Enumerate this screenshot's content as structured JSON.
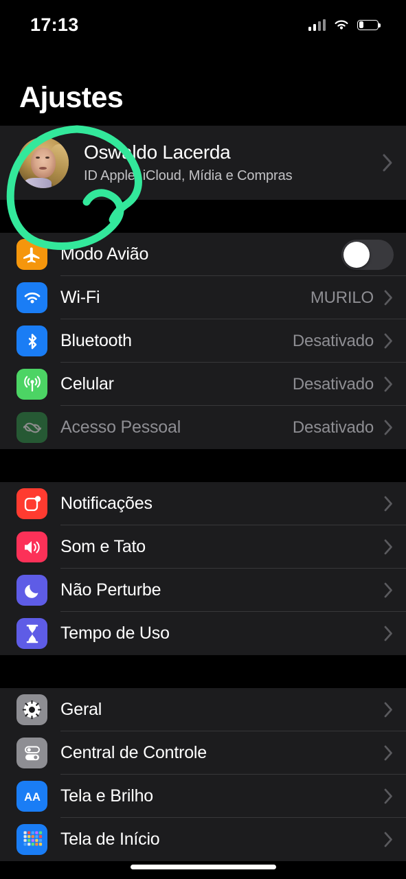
{
  "status_bar": {
    "time": "17:13",
    "cellular_icon": "cellular-signal-icon",
    "cellular_bars_filled": 2,
    "cellular_bars_total": 4,
    "wifi_icon": "wifi-icon",
    "battery_icon": "battery-icon",
    "battery_level_percent": 25
  },
  "header": {
    "title": "Ajustes"
  },
  "profile": {
    "name": "Oswaldo Lacerda",
    "subtitle": "ID Apple, iCloud, Mídia e Compras",
    "avatar_icon": "user-avatar-photo",
    "chevron_icon": "chevron-right-icon"
  },
  "annotation": {
    "name": "green-circle-annotation",
    "color": "#33E89B",
    "stroke_width": 11,
    "target": "avatar"
  },
  "colors": {
    "page_background": "#000000",
    "row_background": "#1c1c1e",
    "separator": "#38383a",
    "primary_text": "#ffffff",
    "secondary_text": "#8e8e93",
    "chevron": "#5a5a5e",
    "toggle_track_off": "#39393d",
    "annotation_green": "#33E89B"
  },
  "groups": [
    {
      "name": "connectivity",
      "rows": [
        {
          "label": "Modo Avião",
          "icon": "airplane-icon",
          "icon_color": "#F5960C",
          "control": "toggle",
          "toggle_on": false,
          "disabled": false
        },
        {
          "label": "Wi-Fi",
          "icon": "wifi-icon",
          "icon_color": "#1A7DF5",
          "value": "MURILO",
          "control": "chevron",
          "disabled": false
        },
        {
          "label": "Bluetooth",
          "icon": "bluetooth-icon",
          "icon_color": "#1A7DF5",
          "value": "Desativado",
          "control": "chevron",
          "disabled": false
        },
        {
          "label": "Celular",
          "icon": "antenna-icon",
          "icon_color": "#4CD464",
          "value": "Desativado",
          "control": "chevron",
          "disabled": false
        },
        {
          "label": "Acesso Pessoal",
          "icon": "link-icon",
          "icon_color": "#34A853",
          "value": "Desativado",
          "control": "chevron",
          "disabled": true
        }
      ]
    },
    {
      "name": "notifications",
      "rows": [
        {
          "label": "Notificações",
          "icon": "notifications-badge-icon",
          "icon_color": "#FF3B30",
          "control": "chevron",
          "disabled": false
        },
        {
          "label": "Som e Tato",
          "icon": "speaker-icon",
          "icon_color": "#FC3158",
          "control": "chevron",
          "disabled": false
        },
        {
          "label": "Não Perturbe",
          "icon": "moon-icon",
          "icon_color": "#5E5CE6",
          "control": "chevron",
          "disabled": false
        },
        {
          "label": "Tempo de Uso",
          "icon": "hourglass-icon",
          "icon_color": "#5E5CE6",
          "control": "chevron",
          "disabled": false
        }
      ]
    },
    {
      "name": "system",
      "rows": [
        {
          "label": "Geral",
          "icon": "gear-icon",
          "icon_color": "#8E8E93",
          "control": "chevron",
          "disabled": false
        },
        {
          "label": "Central de Controle",
          "icon": "control-toggles-icon",
          "icon_color": "#8E8E93",
          "control": "chevron",
          "disabled": false
        },
        {
          "label": "Tela e Brilho",
          "icon": "text-size-aa-icon",
          "icon_color": "#1A7DF5",
          "control": "chevron",
          "disabled": false
        },
        {
          "label": "Tela de Início",
          "icon": "app-grid-icon",
          "icon_color": "#1A7DF5",
          "control": "chevron",
          "disabled": false
        }
      ]
    }
  ],
  "home_indicator": {
    "name": "home-indicator"
  }
}
